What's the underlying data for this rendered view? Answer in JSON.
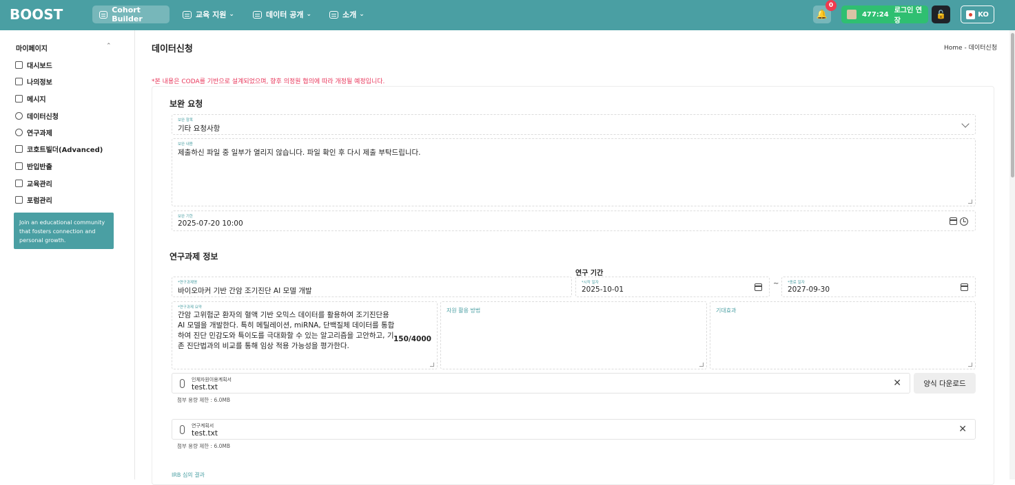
{
  "header": {
    "logo": "BOOST",
    "nav": [
      {
        "label": "Cohort Builder",
        "icon": "grid-icon"
      },
      {
        "label": "교육 지원",
        "icon": "book-icon"
      },
      {
        "label": "데이터 공개",
        "icon": "doc-icon"
      },
      {
        "label": "소개",
        "icon": "info-icon"
      }
    ],
    "notification_count": "0",
    "timer": "477:24",
    "login_extend_label": "로그인 연장",
    "lang": "KO"
  },
  "sidebar": {
    "section_title": "마이페이지",
    "items": [
      {
        "label": "대시보드",
        "icon": "dashboard-icon"
      },
      {
        "label": "나의정보",
        "icon": "user-info-icon"
      },
      {
        "label": "메시지",
        "icon": "message-icon"
      },
      {
        "label": "데이터신청",
        "icon": "data-request-icon"
      },
      {
        "label": "연구과제",
        "icon": "research-icon"
      },
      {
        "label": "코호트빌더(Advanced)",
        "icon": "cohort-icon"
      },
      {
        "label": "반입반출",
        "icon": "transfer-icon"
      },
      {
        "label": "교육관리",
        "icon": "education-icon"
      },
      {
        "label": "포럼관리",
        "icon": "forum-icon"
      }
    ],
    "promo": "Join an educational community that fosters connection and personal growth."
  },
  "page": {
    "title": "데이터신청",
    "breadcrumb_home": "Home",
    "breadcrumb_sep": "-",
    "breadcrumb_current": "데이터신청",
    "notice": "*본 내용은 CODA를 기반으로 설계되었으며, 향후 의정원 협의에 따라 개정될 예정입니다."
  },
  "supplement": {
    "section_title": "보완 요청",
    "item_label": "보완 항목",
    "item_value": "기타 요청사항",
    "content_label": "보완 내용",
    "content_value": "제출하신 파일 중 일부가 열리지 않습니다. 파일 확인 후 다시 제출 부탁드립니다.",
    "deadline_label": "보완 기한",
    "deadline_value": "2025-07-20 10:00"
  },
  "research": {
    "section_title": "연구과제 정보",
    "period_label": "연구 기간",
    "name_label": "*연구과제명",
    "name_value": "바이오마커 기반 간암 조기진단 AI 모델 개발",
    "start_label": "*시작 일자",
    "start_value": "2025-10-01",
    "tilde": "~",
    "end_label": "*종료 일자",
    "end_value": "2027-09-30",
    "summary_label": "*연구과제 요약",
    "summary_value": "간암 고위험군 환자의 혈액 기반 오믹스 데이터를 활용하여 조기진단용 AI 모델을 개발한다. 특히 메틸레이션, miRNA, 단백질체 데이터를 통합하여 진단 민감도와 특이도를 극대화할 수 있는 알고리즘을 고안하고, 기존 진단법과의 비교를 통해 임상 적용 가능성을 평가한다.",
    "summary_count": "150/4000",
    "resource_label": "자원 활용 방법",
    "effect_label": "기대효과",
    "file1_label": "인체자원이용계획서",
    "file1_value": "test.txt",
    "file1_help": "첨부 용량 제한 : 6.0MB",
    "download_label": "양식 다운로드",
    "file2_label": "연구계획서",
    "file2_value": "test.txt",
    "file2_help": "첨부 용량 제한 : 6.0MB",
    "irb_label": "IRB 심의 결과"
  }
}
